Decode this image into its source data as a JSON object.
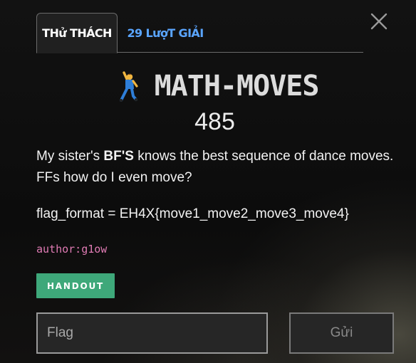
{
  "tabs": {
    "challenge": "THử THÁCH",
    "solves": "29 LượT GIẢI"
  },
  "challenge": {
    "emoji_icon": "dancer-icon",
    "title": "MATH-MOVES",
    "points": "485",
    "description_part1": "My sister's ",
    "description_bold": "BF'S",
    "description_part2": " knows the best sequence of dance moves. FFs how do I even move?",
    "flag_format": "flag_format = EH4X{move1_move2_move3_move4}",
    "author": "author:g1ow"
  },
  "handout": {
    "label": "HANDOUT"
  },
  "flag_form": {
    "placeholder": "Flag",
    "submit_label": "Gửi"
  },
  "colors": {
    "tab_inactive": "#5aa5ff",
    "handout": "#3ea87a",
    "author": "#e07bb4"
  }
}
